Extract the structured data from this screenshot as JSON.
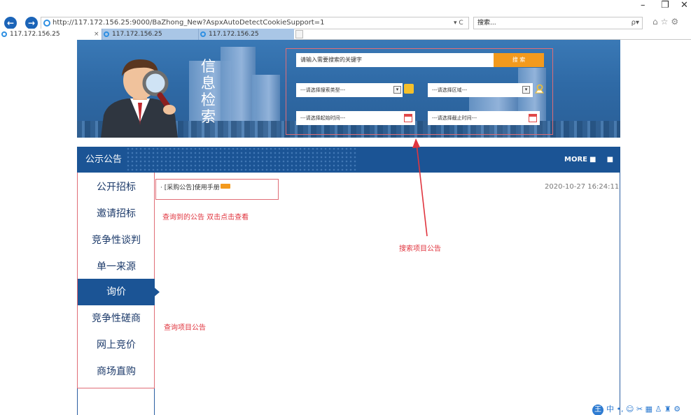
{
  "browser": {
    "address": "http://117.172.156.25:9000/BaZhong_New?AspxAutoDetectCookieSupport=1",
    "address_controls": "▾ C",
    "search_placeholder": "搜索...",
    "search_icon_glyph": "ρ▾",
    "tabs": [
      {
        "label": "117.172.156.25"
      },
      {
        "label": "117.172.156.25"
      },
      {
        "label": "117.172.156.25"
      }
    ],
    "tab_close": "×",
    "window_controls": {
      "minimize": "–",
      "restore": "❐",
      "close": "✕"
    },
    "toolbar_icons": "⌂☆⚙"
  },
  "banner": {
    "title_chars": [
      "信",
      "息",
      "检",
      "索"
    ],
    "keyword_placeholder": "请输入需要搜索的关键字",
    "search_button": "搜 索",
    "select_type": "---请选择搜索类型---",
    "select_area": "---请选择区域---",
    "start_time": "---请选择起始时间---",
    "end_time": "---请选择截止时间---"
  },
  "bulletin": {
    "title": "公示公告",
    "more": "MORE",
    "more_dots": "■ ■ ■"
  },
  "sidebar": {
    "items": [
      {
        "label": "公开招标"
      },
      {
        "label": "邀请招标"
      },
      {
        "label": "竞争性谈判"
      },
      {
        "label": "单一来源"
      },
      {
        "label": "询价"
      },
      {
        "label": "竞争性磋商"
      },
      {
        "label": "网上竞价"
      },
      {
        "label": "商场直购"
      }
    ],
    "active_label": "询价"
  },
  "announcements": [
    {
      "title": "· [采购公告]使用手册",
      "date": "2020-10-27 16:24:11"
    }
  ],
  "notes": {
    "double_click": "查询到的公告 双击点击查看",
    "search_project": "搜索项目公告",
    "query_project": "查询项目公告"
  },
  "ime": {
    "badge": "王",
    "text": "中 •, ☺ ✂ ▦ ♙ ♜ ⚙"
  },
  "colors": {
    "brand_blue": "#1b5495",
    "accent_orange": "#f39a1d",
    "annotation_red": "#e0353f"
  }
}
